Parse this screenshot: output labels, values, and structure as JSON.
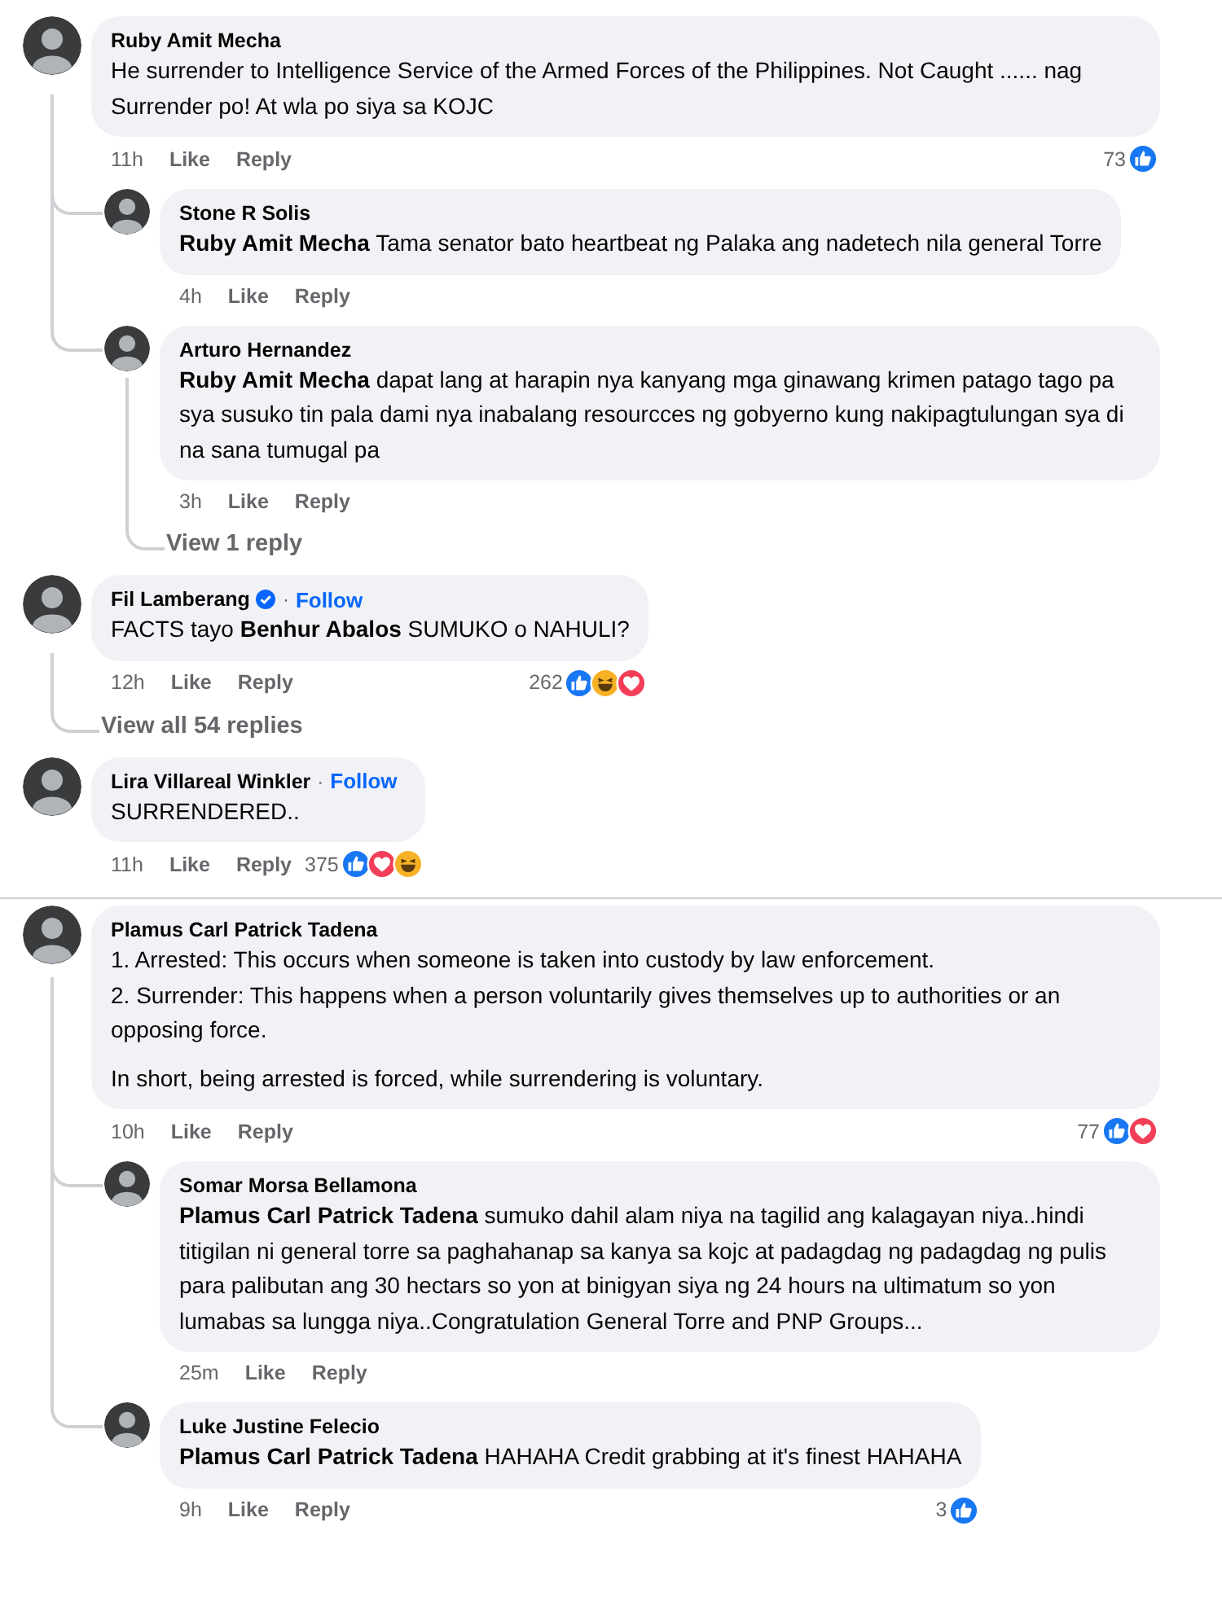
{
  "comments": [
    {
      "author": "Ruby Amit Mecha",
      "text": [
        "He surrender to Intelligence Service of the Armed Forces of the Philippines. Not Caught ...... nag Surrender po! At wla po siya sa KOJC"
      ],
      "time": "11h",
      "like": "Like",
      "reply": "Reply",
      "reactions": {
        "count": "73",
        "kinds": [
          {
            "kind": "like"
          }
        ]
      },
      "replies": [
        {
          "author": "Stone R Solis",
          "text": [
            "**Ruby Amit Mecha** Tama senator bato heartbeat ng Palaka ang nadetech nila general Torre"
          ],
          "time": "4h",
          "like": "Like",
          "reply": "Reply"
        },
        {
          "author": "Arturo Hernandez",
          "text": [
            "**Ruby Amit Mecha** dapat lang at harapin nya kanyang mga ginawang krimen patago tago pa sya susuko tin pala dami nya inabalang resourcces ng gobyerno kung nakipagtulungan sya di na sana tumugal pa"
          ],
          "time": "3h",
          "like": "Like",
          "reply": "Reply",
          "view_more": "View 1 reply"
        }
      ]
    },
    {
      "author": "Fil Lamberang",
      "verified": true,
      "separator": "·",
      "follow": "Follow",
      "text": [
        "FACTS tayo **Benhur Abalos** SUMUKO o NAHULI?"
      ],
      "time": "12h",
      "like": "Like",
      "reply": "Reply",
      "reactions": {
        "count": "262",
        "kinds": [
          {
            "kind": "like"
          },
          {
            "kind": "haha"
          },
          {
            "kind": "love"
          }
        ]
      },
      "view_more": "View all 54 replies"
    },
    {
      "author": "Lira Villareal Winkler",
      "separator": "·",
      "follow": "Follow",
      "text": [
        "SURRENDERED.."
      ],
      "time": "11h",
      "like": "Like",
      "reply": "Reply",
      "reactions": {
        "count": "375",
        "kinds": [
          {
            "kind": "like"
          },
          {
            "kind": "love"
          },
          {
            "kind": "haha"
          }
        ]
      }
    },
    {
      "author": "Plamus Carl Patrick Tadena",
      "text": [
        "1. Arrested: This occurs when someone is taken into custody by law enforcement.\n2. Surrender: This happens when a person voluntarily gives themselves up to authorities or an opposing force.",
        "In short, being arrested is forced, while surrendering is voluntary."
      ],
      "time": "10h",
      "like": "Like",
      "reply": "Reply",
      "reactions": {
        "count": "77",
        "kinds": [
          {
            "kind": "like"
          },
          {
            "kind": "love"
          }
        ]
      },
      "replies": [
        {
          "author": "Somar Morsa Bellamona",
          "text": [
            "**Plamus Carl Patrick Tadena** sumuko dahil alam niya na tagilid ang kalagayan niya..hindi titigilan ni general torre sa paghahanap sa kanya sa kojc at padagdag ng padagdag ng pulis para palibutan ang 30 hectars so yon at binigyan siya ng 24 hours na ultimatum so yon lumabas sa lungga niya..Congratulation General Torre and PNP Groups..."
          ],
          "time": "25m",
          "like": "Like",
          "reply": "Reply"
        },
        {
          "author": "Luke Justine Felecio",
          "text": [
            "**Plamus Carl Patrick Tadena** HAHAHA Credit grabbing at it's finest HAHAHA"
          ],
          "time": "9h",
          "like": "Like",
          "reply": "Reply",
          "reactions": {
            "count": "3",
            "kinds": [
              {
                "kind": "like"
              }
            ]
          }
        }
      ]
    }
  ]
}
